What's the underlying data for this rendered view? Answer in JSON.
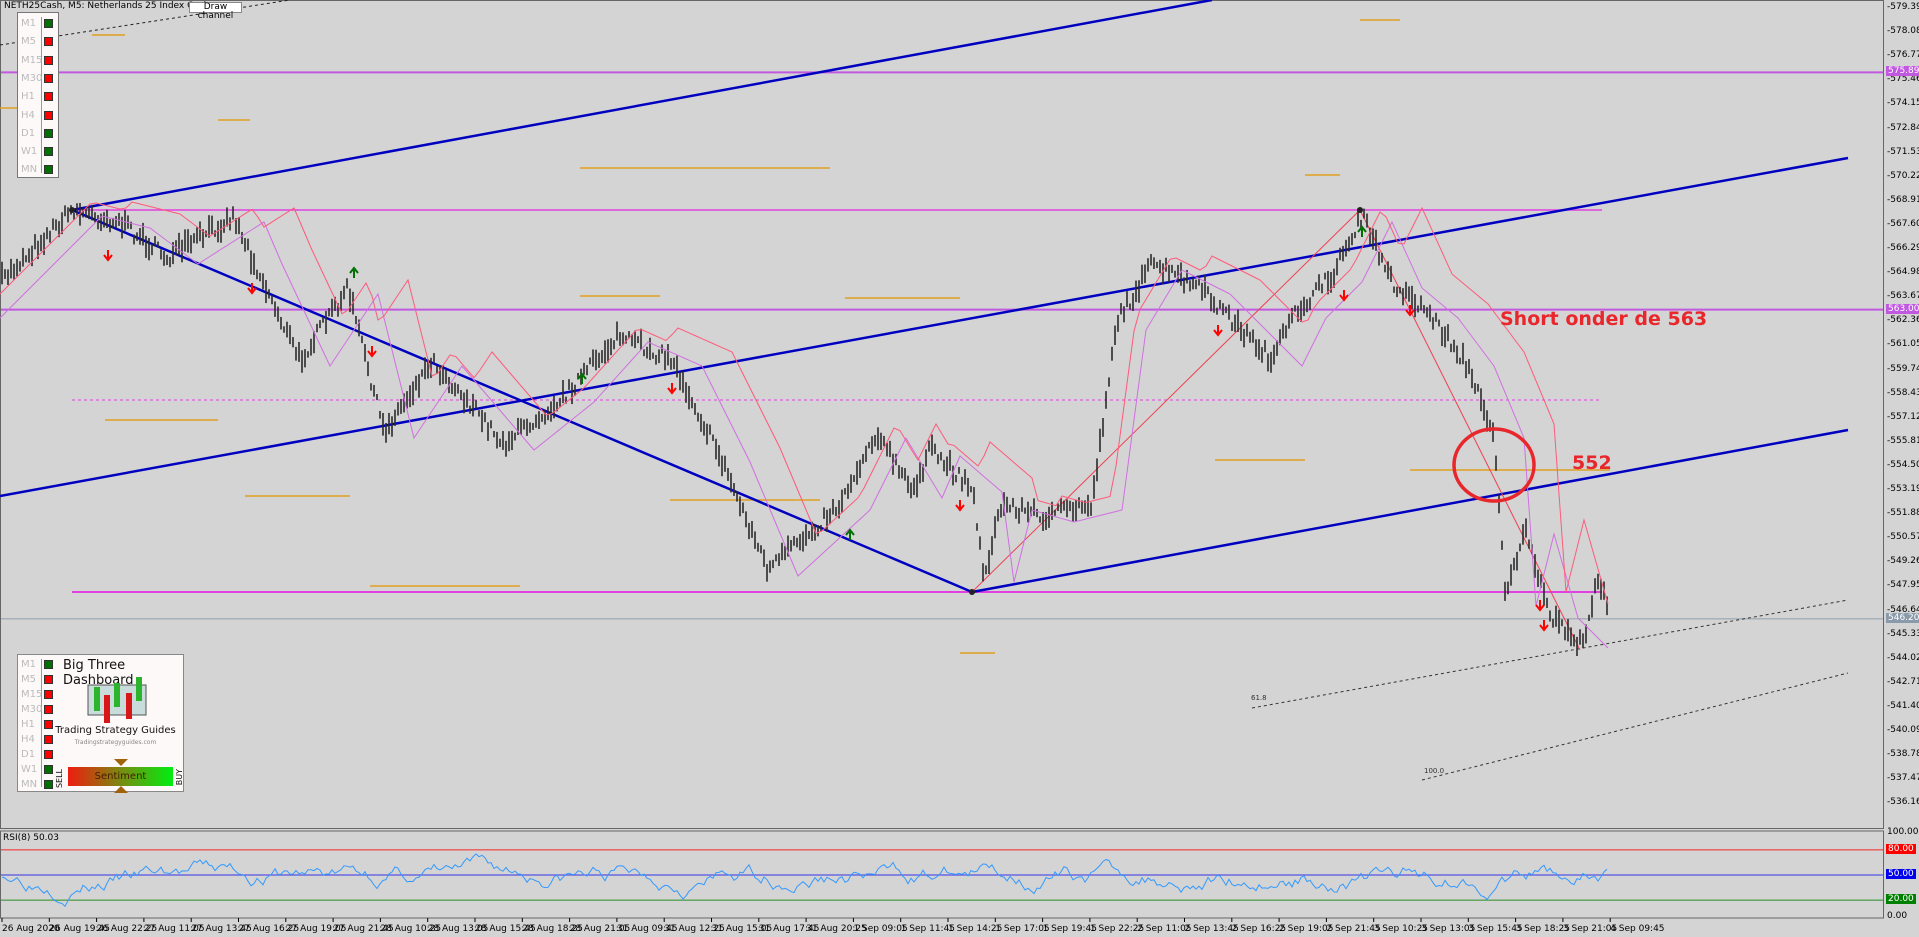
{
  "header": {
    "title": "NETH25Cash, M5:  Netherlands 25 Index Cash",
    "draw_channel_button": "Draw channel"
  },
  "timeframes": [
    {
      "label": "M1",
      "status": "green"
    },
    {
      "label": "M5",
      "status": "red"
    },
    {
      "label": "M15",
      "status": "red"
    },
    {
      "label": "M30",
      "status": "red"
    },
    {
      "label": "H1",
      "status": "red"
    },
    {
      "label": "H4",
      "status": "red"
    },
    {
      "label": "D1",
      "status": "green"
    },
    {
      "label": "W1",
      "status": "green"
    },
    {
      "label": "MN",
      "status": "green"
    }
  ],
  "dashboard": {
    "title": "Big Three Dashboard",
    "brand": "Trading Strategy Guides",
    "url": "Tradingstrategyguides.com",
    "sentiment": "Sentiment",
    "sell": "SELL",
    "buy": "BUY",
    "timeframes": [
      {
        "label": "M1",
        "status": "green"
      },
      {
        "label": "M5",
        "status": "red"
      },
      {
        "label": "M15",
        "status": "red"
      },
      {
        "label": "M30",
        "status": "red"
      },
      {
        "label": "H1",
        "status": "red"
      },
      {
        "label": "H4",
        "status": "red"
      },
      {
        "label": "D1",
        "status": "red"
      },
      {
        "label": "W1",
        "status": "green"
      },
      {
        "label": "MN",
        "status": "green"
      }
    ]
  },
  "price_axis": [
    "579.39",
    "578.08",
    "576.77",
    "575.46",
    "574.15",
    "572.84",
    "571.53",
    "570.22",
    "568.91",
    "567.60",
    "566.29",
    "564.98",
    "563.67",
    "562.36",
    "561.05",
    "559.74",
    "558.43",
    "557.12",
    "555.81",
    "554.50",
    "553.19",
    "551.88",
    "550.57",
    "549.26",
    "547.95",
    "546.64",
    "545.33",
    "544.02",
    "542.71",
    "541.40",
    "540.09",
    "538.78",
    "537.47",
    "536.16"
  ],
  "price_tags": [
    {
      "value": "575.89",
      "color": "#c058e0"
    },
    {
      "value": "563.00",
      "color": "#c058e0"
    },
    {
      "value": "546.20",
      "color": "#8a9aaa"
    }
  ],
  "rsi": {
    "label": "RSI(8) 50.03",
    "levels": [
      {
        "value": "100.00"
      },
      {
        "value": "80.00",
        "color": "#ff0000"
      },
      {
        "value": "50.00",
        "color": "#0000ee"
      },
      {
        "value": "20.00",
        "color": "#008000"
      },
      {
        "value": "0.00"
      }
    ]
  },
  "time_axis": [
    "26 Aug 2020",
    "26 Aug 19:45",
    "26 Aug 22:25",
    "27 Aug 11:05",
    "27 Aug 13:45",
    "27 Aug 16:25",
    "27 Aug 19:05",
    "27 Aug 21:45",
    "28 Aug 10:25",
    "28 Aug 13:05",
    "28 Aug 15:45",
    "28 Aug 18:25",
    "28 Aug 21:05",
    "31 Aug 09:45",
    "31 Aug 12:25",
    "31 Aug 15:05",
    "31 Aug 17:45",
    "31 Aug 20:25",
    "1 Sep 09:05",
    "1 Sep 11:45",
    "1 Sep 14:25",
    "1 Sep 17:05",
    "1 Sep 19:45",
    "1 Sep 22:25",
    "2 Sep 11:05",
    "2 Sep 13:45",
    "2 Sep 16:25",
    "2 Sep 19:05",
    "2 Sep 21:45",
    "3 Sep 10:25",
    "3 Sep 13:05",
    "3 Sep 15:45",
    "3 Sep 18:25",
    "3 Sep 21:05",
    "4 Sep 09:45"
  ],
  "annotations": {
    "short": "Short onder de 563",
    "level": "552",
    "fib1": "61.8",
    "fib2": "100.0"
  },
  "colors": {
    "channel": "#0000c0",
    "level": "#e040e0",
    "support": "#e0a020",
    "annotation": "#e8262b",
    "rsi_line": "#3399ff",
    "green": "#007000",
    "red": "#ff0000"
  }
}
